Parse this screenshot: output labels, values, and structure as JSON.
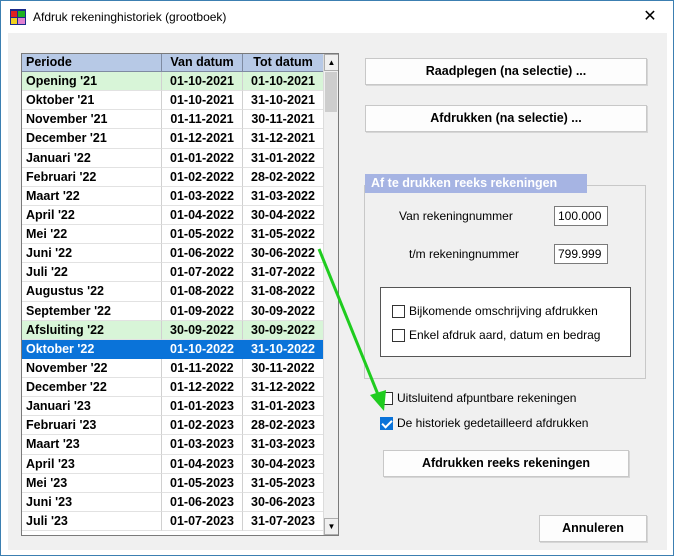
{
  "window": {
    "title": "Afdruk rekeninghistoriek (grootboek)",
    "close_glyph": "✕"
  },
  "list": {
    "columns": [
      "Periode",
      "Van datum",
      "Tot datum"
    ],
    "rows": [
      {
        "periode": "Opening '21",
        "van": "01-10-2021",
        "tot": "01-10-2021",
        "style": "green"
      },
      {
        "periode": "Oktober '21",
        "van": "01-10-2021",
        "tot": "31-10-2021",
        "style": ""
      },
      {
        "periode": "November '21",
        "van": "01-11-2021",
        "tot": "30-11-2021",
        "style": ""
      },
      {
        "periode": "December '21",
        "van": "01-12-2021",
        "tot": "31-12-2021",
        "style": ""
      },
      {
        "periode": "Januari '22",
        "van": "01-01-2022",
        "tot": "31-01-2022",
        "style": ""
      },
      {
        "periode": "Februari '22",
        "van": "01-02-2022",
        "tot": "28-02-2022",
        "style": ""
      },
      {
        "periode": "Maart '22",
        "van": "01-03-2022",
        "tot": "31-03-2022",
        "style": ""
      },
      {
        "periode": "April '22",
        "van": "01-04-2022",
        "tot": "30-04-2022",
        "style": ""
      },
      {
        "periode": "Mei '22",
        "van": "01-05-2022",
        "tot": "31-05-2022",
        "style": ""
      },
      {
        "periode": "Juni '22",
        "van": "01-06-2022",
        "tot": "30-06-2022",
        "style": ""
      },
      {
        "periode": "Juli '22",
        "van": "01-07-2022",
        "tot": "31-07-2022",
        "style": ""
      },
      {
        "periode": "Augustus '22",
        "van": "01-08-2022",
        "tot": "31-08-2022",
        "style": ""
      },
      {
        "periode": "September '22",
        "van": "01-09-2022",
        "tot": "30-09-2022",
        "style": ""
      },
      {
        "periode": "Afsluiting '22",
        "van": "30-09-2022",
        "tot": "30-09-2022",
        "style": "green"
      },
      {
        "periode": "Oktober '22",
        "van": "01-10-2022",
        "tot": "31-10-2022",
        "style": "selected"
      },
      {
        "periode": "November '22",
        "van": "01-11-2022",
        "tot": "30-11-2022",
        "style": ""
      },
      {
        "periode": "December '22",
        "van": "01-12-2022",
        "tot": "31-12-2022",
        "style": ""
      },
      {
        "periode": "Januari '23",
        "van": "01-01-2023",
        "tot": "31-01-2023",
        "style": ""
      },
      {
        "periode": "Februari '23",
        "van": "01-02-2023",
        "tot": "28-02-2023",
        "style": ""
      },
      {
        "periode": "Maart '23",
        "van": "01-03-2023",
        "tot": "31-03-2023",
        "style": ""
      },
      {
        "periode": "April '23",
        "van": "01-04-2023",
        "tot": "30-04-2023",
        "style": ""
      },
      {
        "periode": "Mei '23",
        "van": "01-05-2023",
        "tot": "31-05-2023",
        "style": ""
      },
      {
        "periode": "Juni '23",
        "van": "01-06-2023",
        "tot": "30-06-2023",
        "style": ""
      },
      {
        "periode": "Juli '23",
        "van": "01-07-2023",
        "tot": "31-07-2023",
        "style": ""
      }
    ]
  },
  "buttons": {
    "raadplegen": "Raadplegen (na selectie) ...",
    "afdrukken": "Afdrukken (na selectie) ...",
    "afdrukken_reeks": "Afdrukken reeks rekeningen",
    "annuleren": "Annuleren"
  },
  "group": {
    "title": "Af te drukken reeks rekeningen",
    "van_label": "Van rekeningnummer",
    "van_value": "100.000",
    "tm_label": "t/m rekeningnummer",
    "tm_value": "799.999"
  },
  "options": {
    "bijkomende": {
      "label": "Bijkomende omschrijving afdrukken",
      "checked": false
    },
    "enkel": {
      "label": "Enkel afdruk aard, datum en bedrag",
      "checked": false
    },
    "uitsluitend": {
      "label": "Uitsluitend afpuntbare rekeningen",
      "checked": false
    },
    "historiek": {
      "label": "De historiek gedetailleerd afdrukken",
      "checked": true
    }
  },
  "colors": {
    "accent": "#0a73d9",
    "group_title_bg": "#a6b4e3",
    "highlight_row": "#d8f5d8",
    "annotation_arrow": "#1fcc1f"
  }
}
